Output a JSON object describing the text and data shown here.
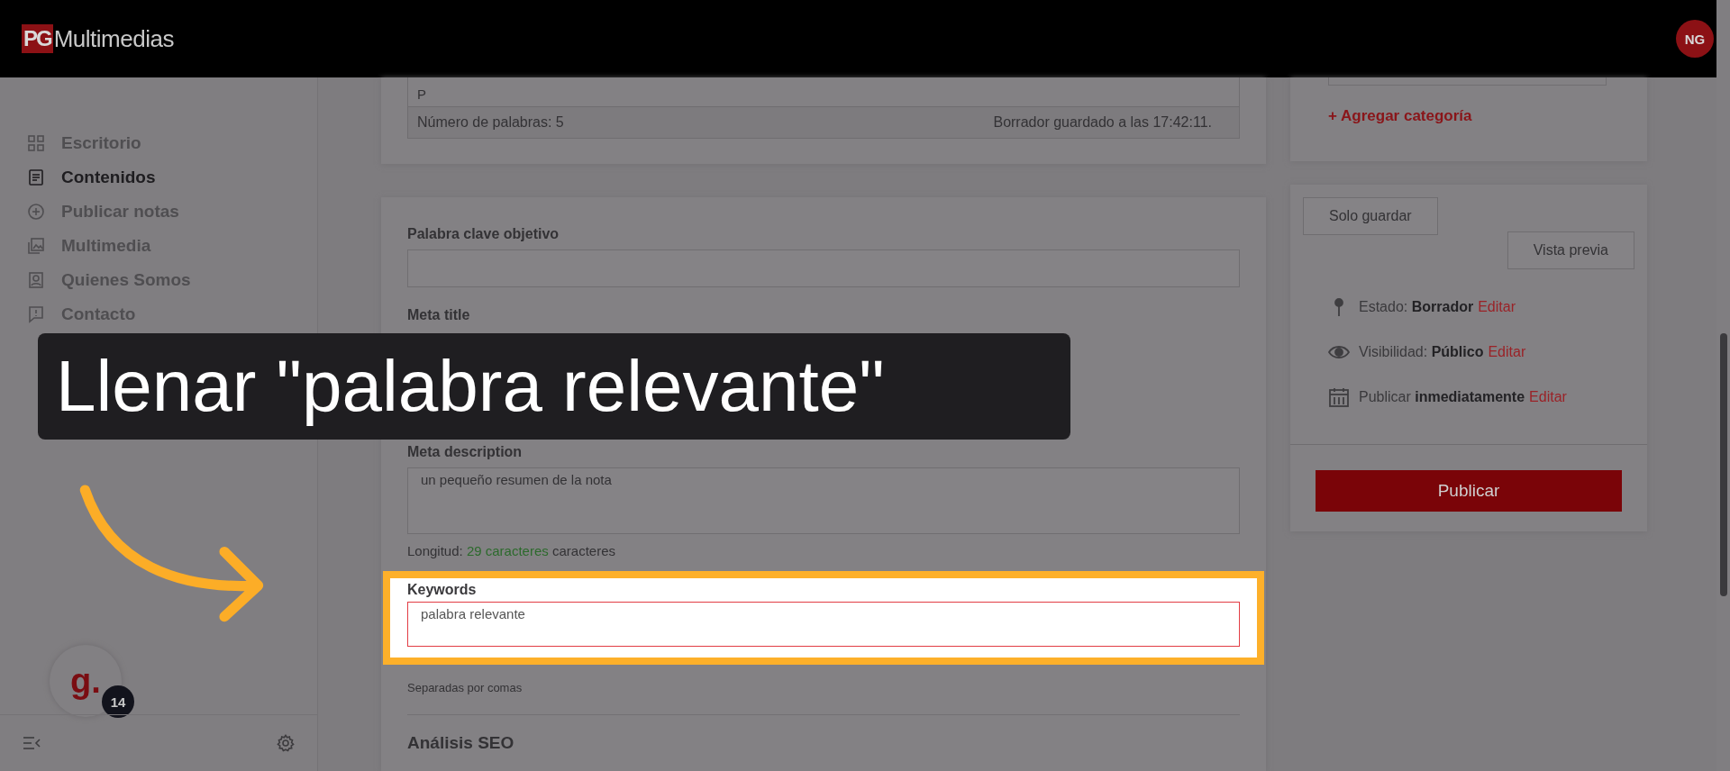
{
  "topbar": {
    "logo_mark": "PG",
    "logo_text": "Multimedias",
    "avatar": "NG"
  },
  "sidebar": {
    "items": [
      {
        "label": "Escritorio",
        "selected": false
      },
      {
        "label": "Contenidos",
        "selected": true
      },
      {
        "label": "Publicar notas",
        "selected": false
      },
      {
        "label": "Multimedia",
        "selected": false
      },
      {
        "label": "Quienes Somos",
        "selected": false
      },
      {
        "label": "Contacto",
        "selected": false
      }
    ],
    "chat_logo": "g.",
    "chat_badge": "14"
  },
  "editor": {
    "paragraph": "P",
    "word_count": "Número de palabras: 5",
    "draft_status": "Borrador guardado a las 17:42:11."
  },
  "seo": {
    "focus_keyword": {
      "label": "Palabra clave objetivo"
    },
    "meta_title": {
      "label": "Meta title"
    },
    "meta_description": {
      "label": "Meta description",
      "value": "un pequeño resumen de la nota",
      "length_prefix": "Longitud:",
      "length_value": "29 caracteres",
      "length_suffix": "caracteres"
    },
    "keywords": {
      "label": "Keywords",
      "value": "palabra relevante",
      "hint": "Separadas por comas"
    },
    "analysis_title": "Análisis SEO"
  },
  "categories": {
    "add_link": "+ Agregar categoría"
  },
  "publish": {
    "save_button": "Solo guardar",
    "preview_button": "Vista previa",
    "rows": [
      {
        "label": "Estado:",
        "value": "Borrador",
        "action": "Editar"
      },
      {
        "label": "Visibilidad:",
        "value": "Público",
        "action": "Editar"
      },
      {
        "label": "Publicar",
        "value": "inmediatamente",
        "action": "Editar"
      }
    ],
    "publish_button": "Publicar"
  },
  "caption": "Llenar \"palabra relevante\""
}
